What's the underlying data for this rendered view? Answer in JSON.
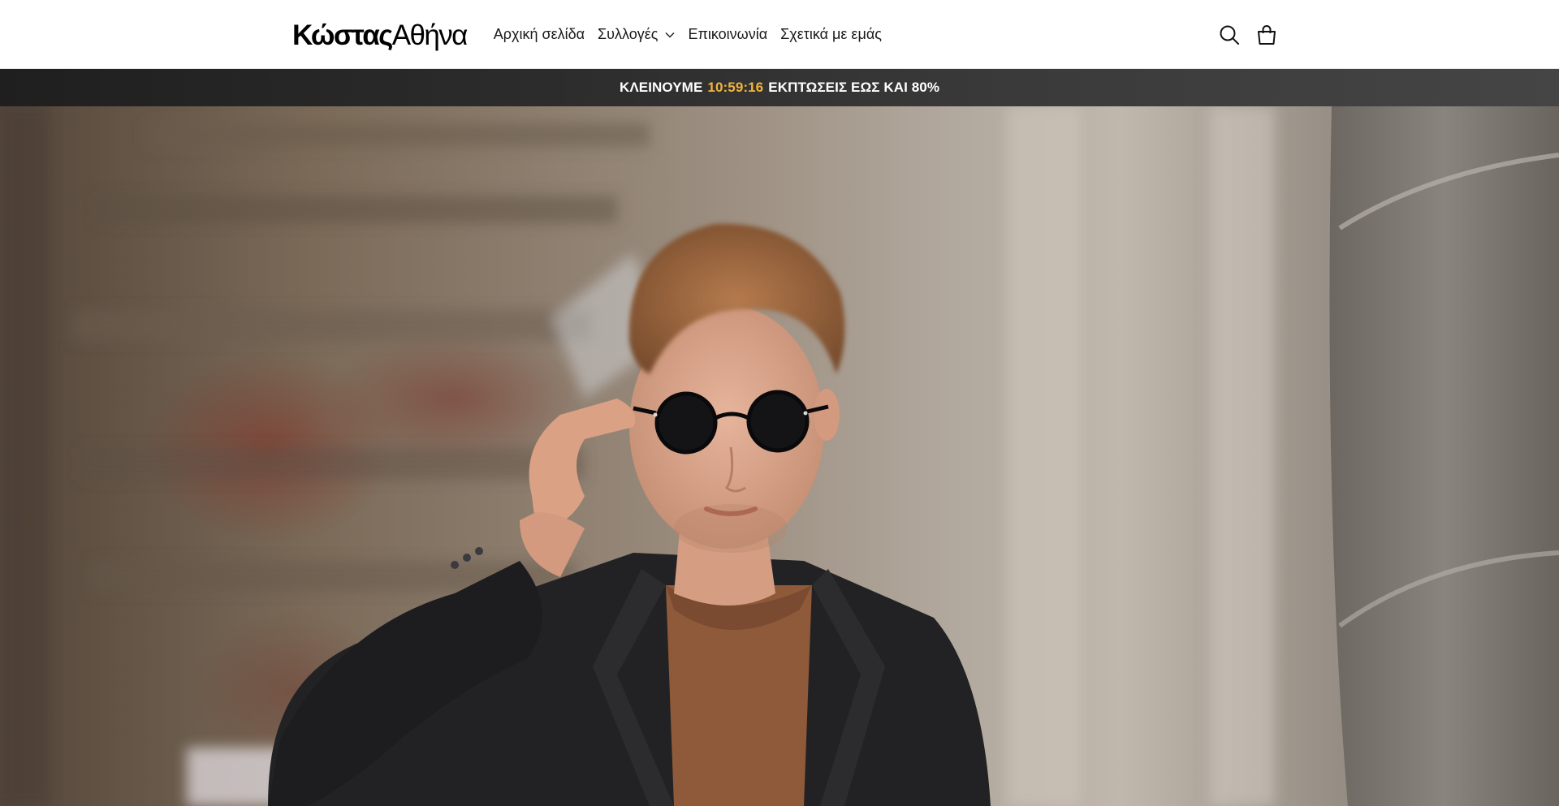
{
  "header": {
    "logo": {
      "bold": "Κώστας",
      "light": "Αθήνα"
    },
    "nav": [
      {
        "label": "Αρχική σελίδα",
        "has_dropdown": false
      },
      {
        "label": "Συλλογές",
        "has_dropdown": true
      },
      {
        "label": "Επικοινωνία",
        "has_dropdown": false
      },
      {
        "label": "Σχετικά με εμάς",
        "has_dropdown": false
      }
    ],
    "icons": {
      "search": "search-icon",
      "cart": "cart-icon"
    }
  },
  "announcement": {
    "before": "ΚΛΕΙΝΟΥΜΕ",
    "timer": "10:59:16",
    "after": "ΕΚΠΤΩΣΕΙΣ ΕΩΣ ΚΑΙ 80%",
    "timer_color": "#f2b33d",
    "bar_color": "#2c2c2c"
  },
  "hero": {
    "image": "man-in-sunglasses-and-black-blazer"
  }
}
